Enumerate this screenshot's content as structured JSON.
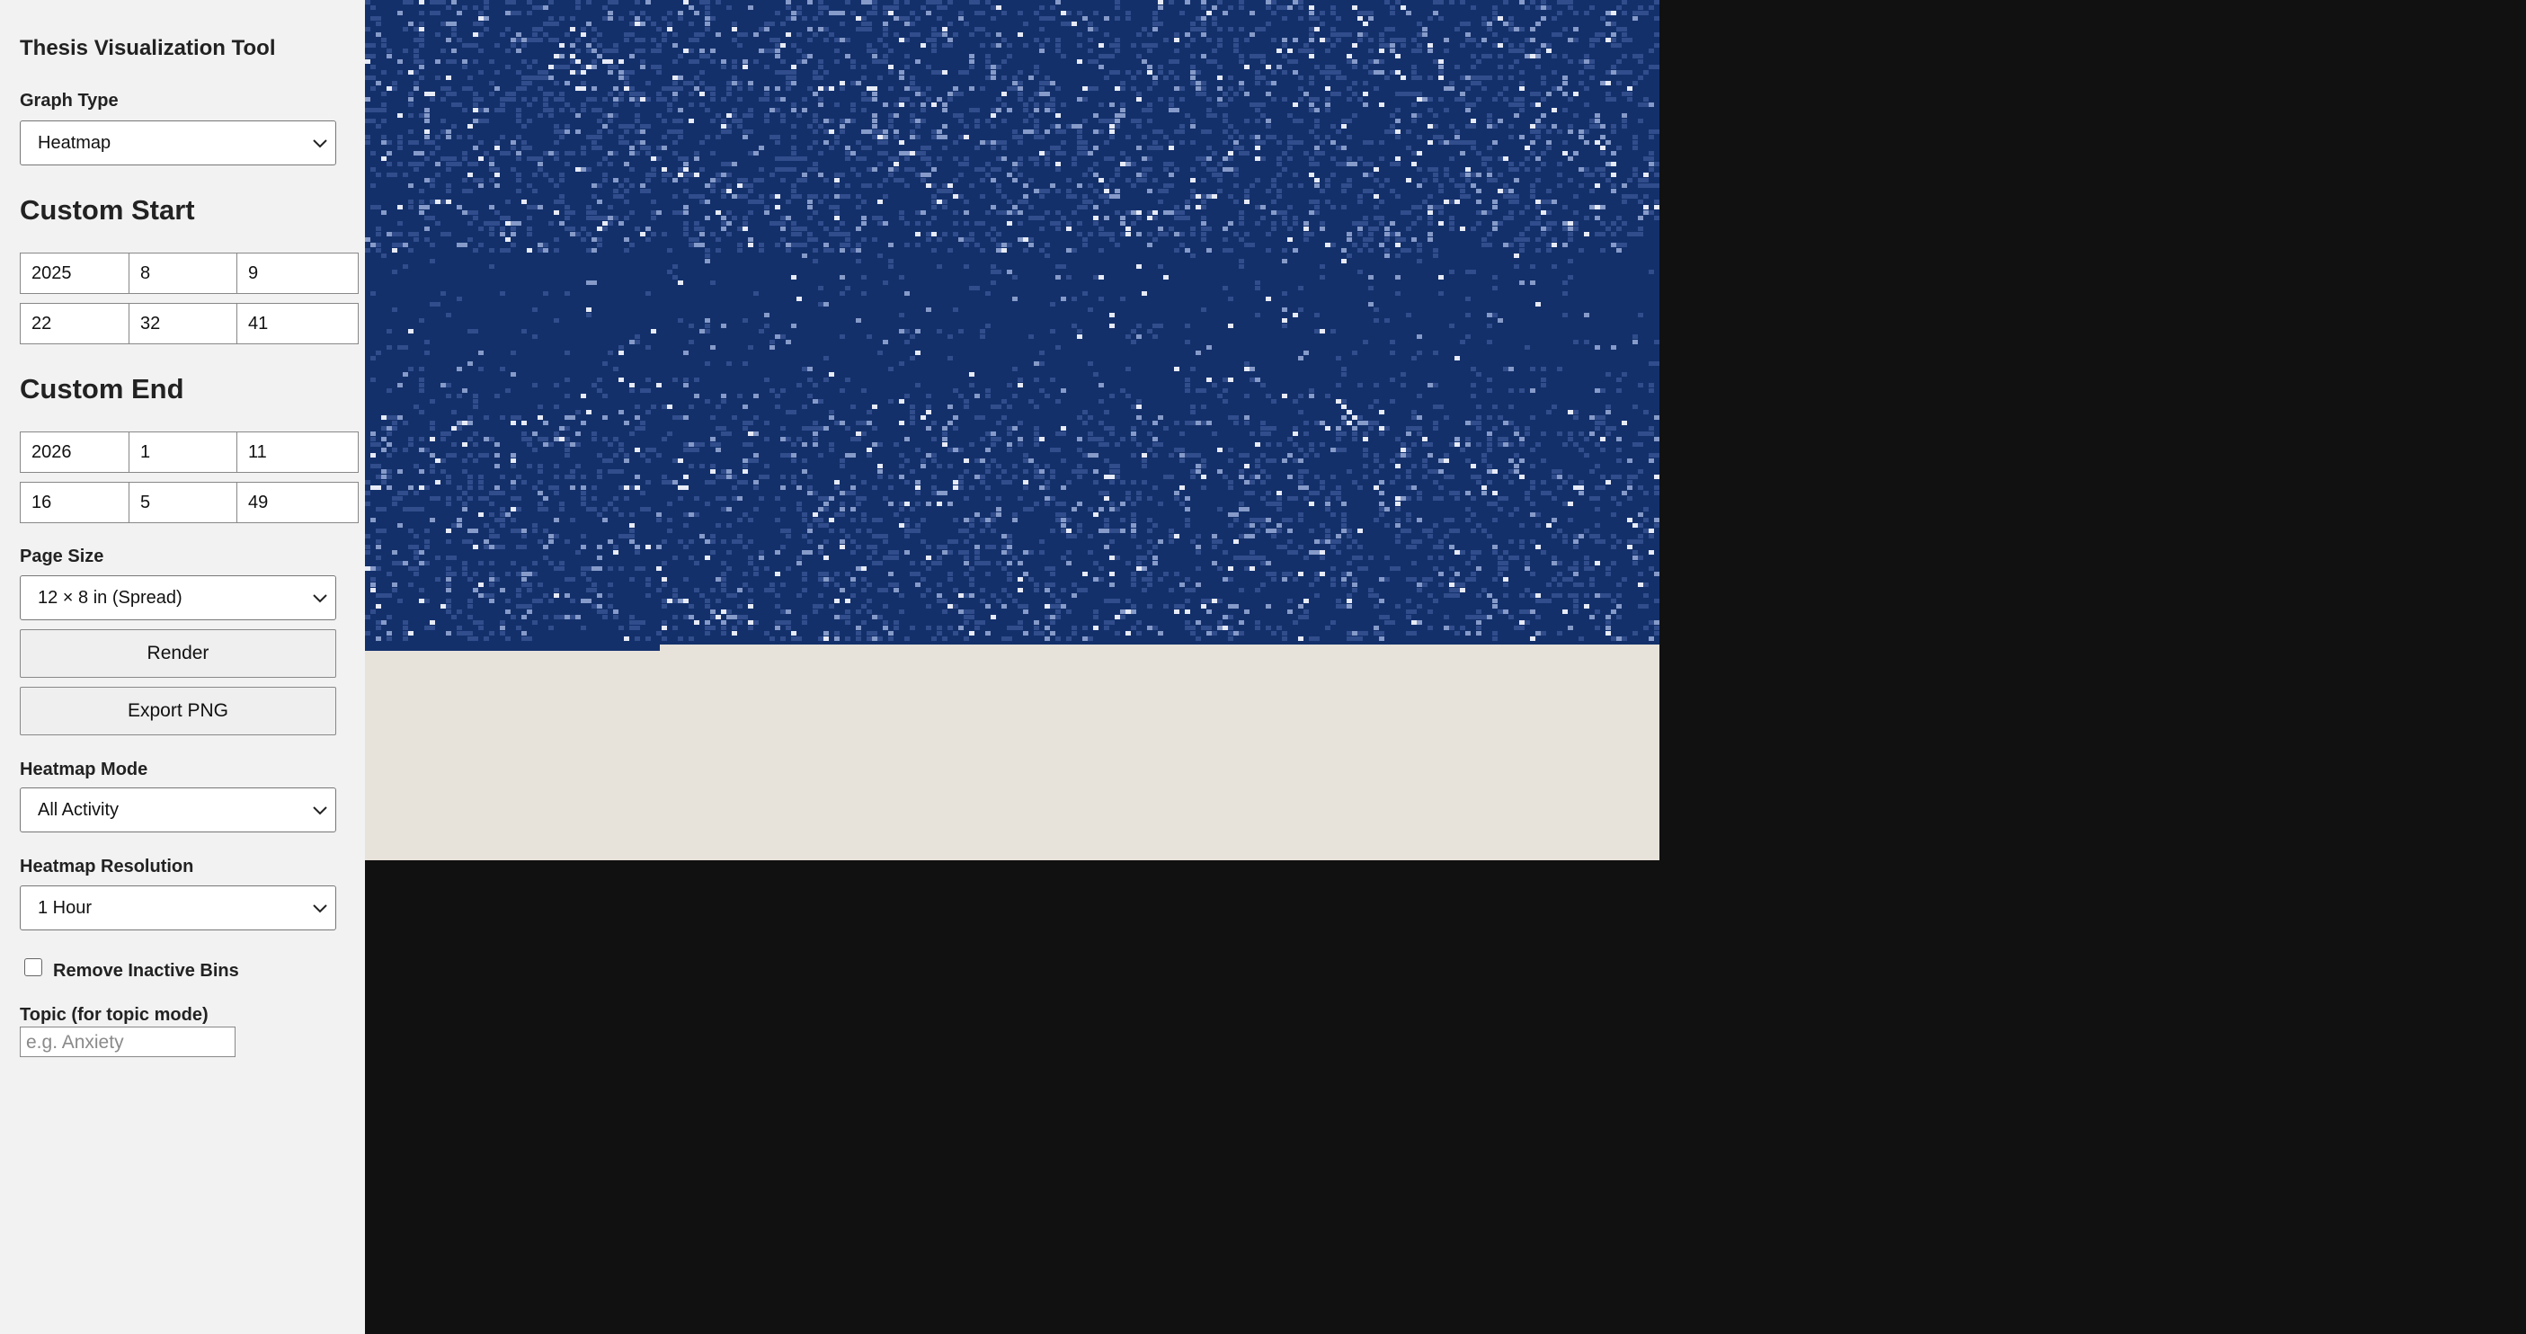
{
  "app": {
    "title": "Thesis Visualization Tool"
  },
  "graph_type": {
    "label": "Graph Type",
    "value": "Heatmap"
  },
  "custom_start": {
    "heading": "Custom Start",
    "year": "2025",
    "month": "8",
    "day": "9",
    "hour": "22",
    "minute": "32",
    "second": "41"
  },
  "custom_end": {
    "heading": "Custom End",
    "year": "2026",
    "month": "1",
    "day": "11",
    "hour": "16",
    "minute": "5",
    "second": "49"
  },
  "page_size": {
    "label": "Page Size",
    "value": "12 × 8 in (Spread)"
  },
  "buttons": {
    "render": "Render",
    "export": "Export PNG"
  },
  "heatmap_mode": {
    "label": "Heatmap Mode",
    "value": "All Activity"
  },
  "heatmap_resolution": {
    "label": "Heatmap Resolution",
    "value": "1 Hour"
  },
  "remove_inactive": {
    "label": "Remove Inactive Bins",
    "checked": false
  },
  "topic": {
    "label": "Topic (for topic mode)",
    "placeholder": "e.g. Anxiety"
  },
  "colors": {
    "sidebar_bg": "#f2f2f2",
    "app_bg": "#111111",
    "canvas_bg": "#e7e2da",
    "heatmap_base": "#13306b",
    "heatmap_high": "#e8eefc"
  },
  "chart_data": {
    "type": "heatmap",
    "icons": [
      "chevron-down-icon"
    ]
  }
}
